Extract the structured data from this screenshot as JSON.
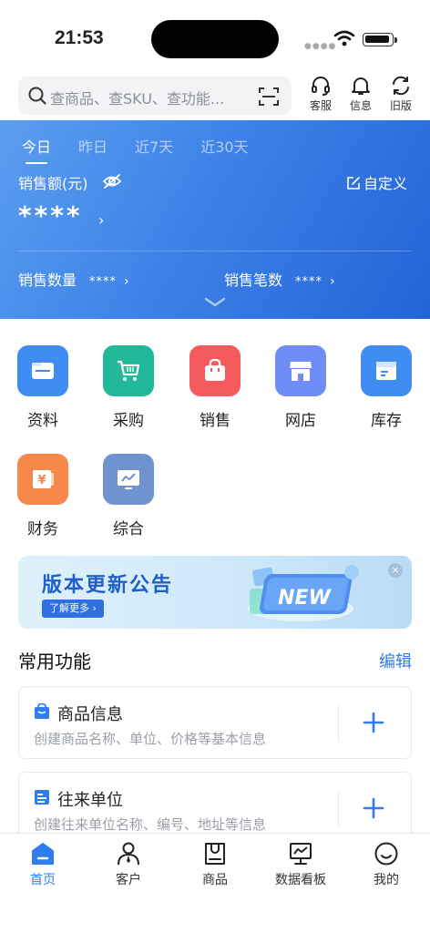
{
  "status_bar": {
    "time": "21:53"
  },
  "header": {
    "search_placeholder": "查商品、查SKU、查功能...",
    "actions": [
      {
        "label": "客服",
        "icon": "headset-icon"
      },
      {
        "label": "信息",
        "icon": "bell-icon"
      },
      {
        "label": "旧版",
        "icon": "refresh-icon"
      }
    ]
  },
  "sales": {
    "tabs": [
      "今日",
      "昨日",
      "近7天",
      "近30天"
    ],
    "active_tab": "今日",
    "amount_label": "销售额(元)",
    "customize_label": "自定义",
    "amount_value": "****",
    "quantity_label": "销售数量",
    "quantity_value": "****",
    "orders_label": "销售笔数",
    "orders_value": "****",
    "arrow": "›"
  },
  "apps": [
    {
      "label": "资料",
      "icon": "folder-icon",
      "color": "#3f8cf2"
    },
    {
      "label": "采购",
      "icon": "cart-icon",
      "color": "#21b99a"
    },
    {
      "label": "销售",
      "icon": "bag-icon",
      "color": "#f45a5e"
    },
    {
      "label": "网店",
      "icon": "store-icon",
      "color": "#6f8cf7"
    },
    {
      "label": "库存",
      "icon": "box-icon",
      "color": "#3f8cf2"
    },
    {
      "label": "财务",
      "icon": "yuan-icon",
      "color": "#f5884a"
    },
    {
      "label": "综合",
      "icon": "monitor-chart-icon",
      "color": "#6e93cf"
    }
  ],
  "banner": {
    "title": "版本更新公告",
    "button": "了解更多 ›",
    "badge": "NEW",
    "close": "×"
  },
  "common": {
    "title": "常用功能",
    "edit_label": "编辑",
    "items": [
      {
        "title": "商品信息",
        "desc": "创建商品名称、单位、价格等基本信息",
        "icon": "goods-bag-icon"
      },
      {
        "title": "往来单位",
        "desc": "创建往来单位名称、编号、地址等信息",
        "icon": "contacts-icon"
      }
    ]
  },
  "tabbar": {
    "items": [
      {
        "label": "首页",
        "icon": "home-icon"
      },
      {
        "label": "客户",
        "icon": "person-icon"
      },
      {
        "label": "商品",
        "icon": "goods-icon"
      },
      {
        "label": "数据看板",
        "icon": "dashboard-icon"
      },
      {
        "label": "我的",
        "icon": "smile-icon"
      }
    ],
    "active": "首页"
  },
  "colors": {
    "accent": "#2f7cf0",
    "header_blue": "#3d82e8"
  }
}
